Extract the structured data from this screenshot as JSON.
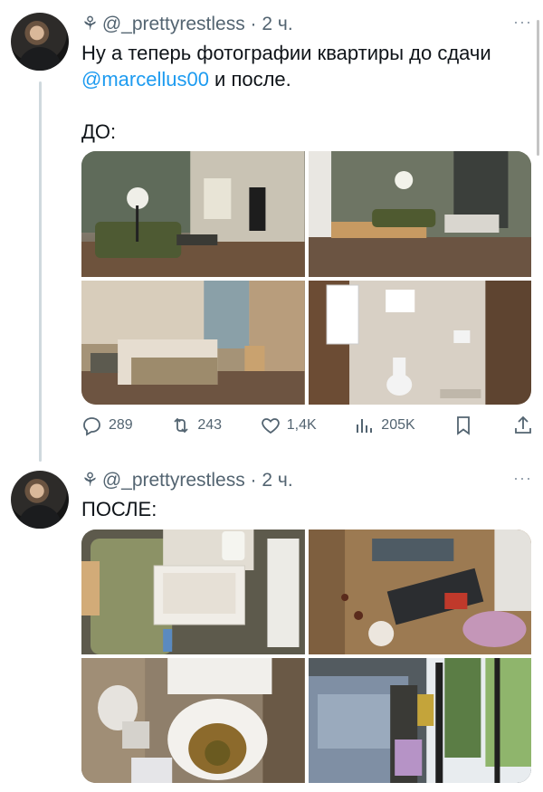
{
  "tweets": [
    {
      "handle": "@_prettyrestless",
      "sigil": "⚘",
      "time": "· 2 ч.",
      "text_before": "Ну а теперь фотографии квартиры до сдачи ",
      "mention": "@marcellus00",
      "text_after": " и после.\n\nДО:",
      "photos": [
        "living-room-photo",
        "dining-area-photo",
        "bedroom-photo",
        "bathroom-photo"
      ],
      "stats": {
        "replies": "289",
        "reposts": "243",
        "likes": "1,4K",
        "views": "205K"
      }
    },
    {
      "handle": "@_prettyrestless",
      "sigil": "⚘",
      "time": "· 2 ч.",
      "text": "ПОСЛЕ:",
      "photos": [
        "messy-drawer-photo",
        "messy-floor-photo",
        "dirty-toilet-photo",
        "messy-bed-photo"
      ]
    }
  ],
  "more_label": "···"
}
